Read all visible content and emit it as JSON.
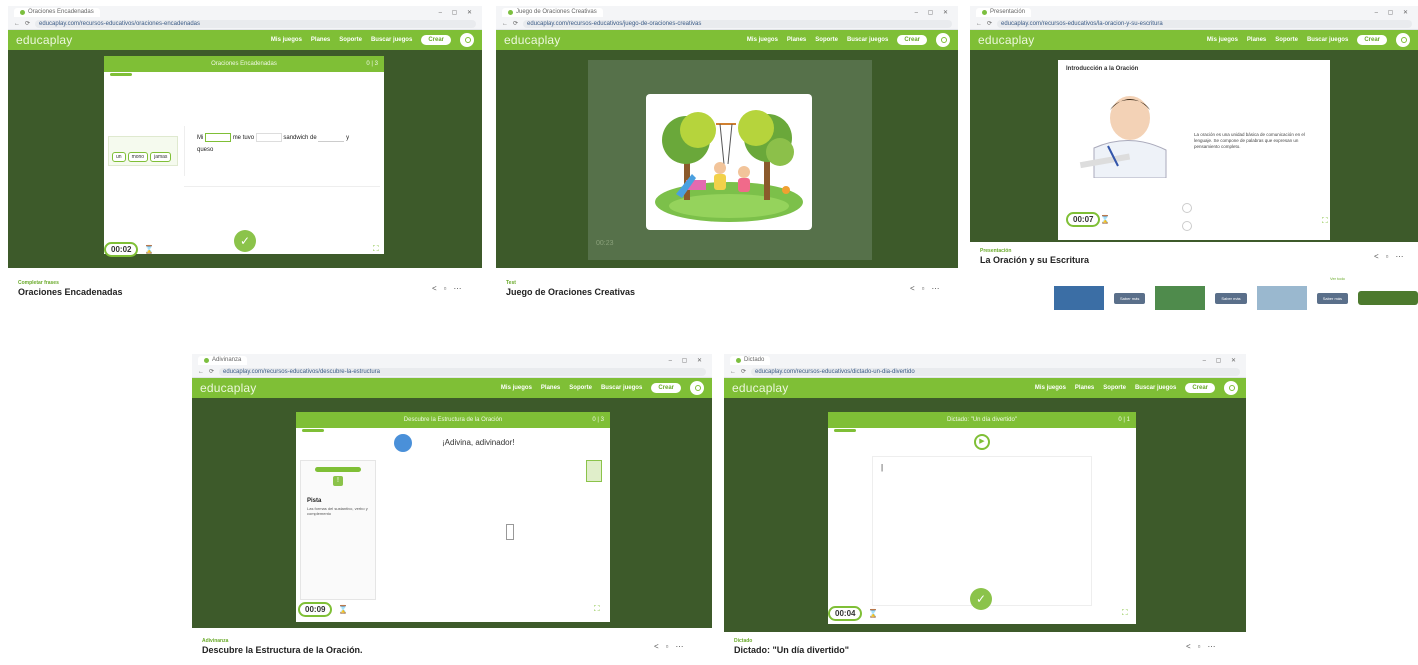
{
  "browser": {
    "app_name": "educaplay",
    "nav": {
      "mis_juegos": "Mis juegos",
      "planes": "Planes",
      "soporte": "Soporte",
      "buscar": "Buscar juegos",
      "crear": "Crear"
    }
  },
  "panels": [
    {
      "tab_title": "Oraciones Encadenadas",
      "url": "educaplay.com/recursos-educativos/oraciones-encadenadas",
      "card_title": "Oraciones Encadenadas",
      "words": [
        "un",
        "mono",
        "jamas"
      ],
      "sentence": {
        "w1": "Mi",
        "w2": "me tuvo",
        "w3": "sandwich de",
        "w4": "y",
        "w5": "queso"
      },
      "timer": "00:02",
      "category": "Completar frases",
      "title": "Oraciones Encadenadas"
    },
    {
      "tab_title": "Juego de Oraciones Creativas",
      "url": "educaplay.com/recursos-educativos/juego-de-oraciones-creativas",
      "timer": "00:23",
      "category": "Test",
      "title": "Juego de Oraciones Creativas"
    },
    {
      "tab_title": "Presentación",
      "url": "educaplay.com/recursos-educativos/la-oracion-y-su-escritura",
      "slide_title": "Introducción a la Oración",
      "slide_text": "La oración es una unidad básica de comunicación en el lenguaje. Se compone de palabras que expresan un pensamiento completo.",
      "timer": "00:07",
      "category": "Presentación",
      "title": "La Oración y su Escritura",
      "more_label": "Ver todo",
      "related": [
        "Saber más",
        "Saber más",
        "Saber más"
      ]
    },
    {
      "tab_title": "Adivinanza",
      "url": "educaplay.com/recursos-educativos/descubre-la-estructura",
      "card_title": "Descubre la Estructura de la Oración",
      "prompt": "¡Adivina, adivinador!",
      "clue_title": "Pista",
      "clue_text": "Las formas del sustantivo, verbo y complemento",
      "timer": "00:09",
      "category": "Adivinanza",
      "title": "Descubre la Estructura de la Oración."
    },
    {
      "tab_title": "Dictado",
      "url": "educaplay.com/recursos-educativos/dictado-un-dia-divertido",
      "card_title": "Dictado: \"Un día divertido\"",
      "timer": "00:04",
      "category": "Dictado",
      "title": "Dictado: \"Un día divertido\""
    }
  ],
  "colors": {
    "brand_green": "#7fbf36",
    "stage_dark": "#3d5a2a",
    "panel_bg": "#ffffff"
  },
  "icons": [
    "share-icon",
    "bookmark-icon",
    "more-icon",
    "check-icon",
    "expand-icon",
    "play-icon",
    "user-icon",
    "hourglass-icon"
  ]
}
